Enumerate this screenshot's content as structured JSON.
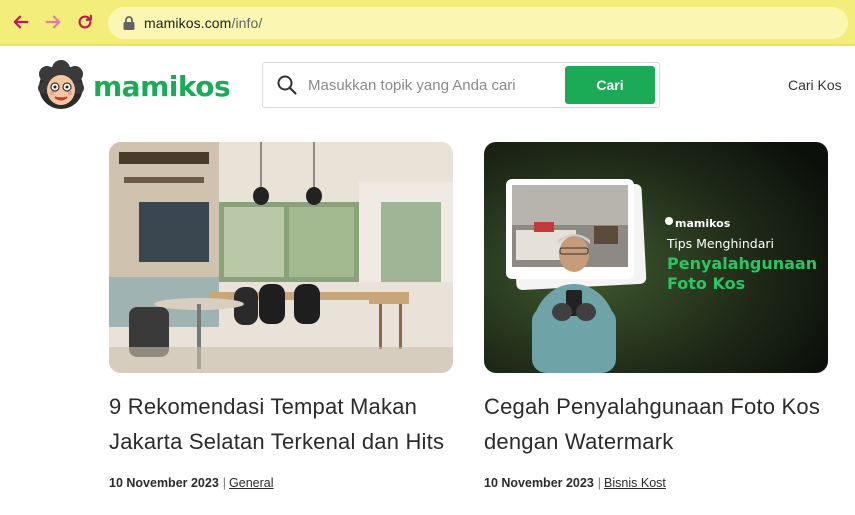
{
  "browser": {
    "url_domain": "mamikos.com",
    "url_path": "/info/"
  },
  "header": {
    "logo_text": "mamikos",
    "search_placeholder": "Masukkan topik yang Anda cari",
    "search_button_label": "Cari",
    "nav_link_label": "Cari Kos"
  },
  "articles": [
    {
      "title": "9 Rekomendasi Tempat Makan Jakarta Selatan Terkenal dan Hits",
      "date": "10 November 2023",
      "category": "General"
    },
    {
      "title": "Cegah Penyalahgunaan Foto Kos dengan Watermark",
      "date": "10 November 2023",
      "category": "Bisnis Kost",
      "thumb_brand": "mamikos",
      "thumb_subtitle": "Tips Menghindari",
      "thumb_headline_1": "Penyalahgunaan",
      "thumb_headline_2": "Foto Kos"
    }
  ],
  "colors": {
    "brand_green": "#1baa56",
    "browser_bar": "#f3ee7a",
    "nav_arrow": "#c2185b"
  }
}
